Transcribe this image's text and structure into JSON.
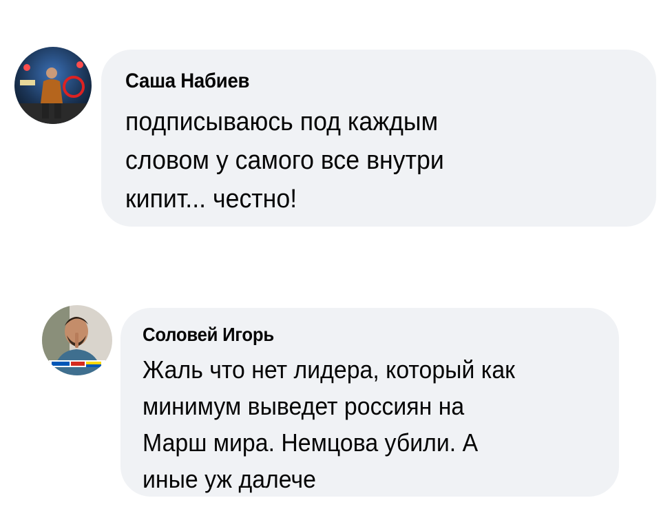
{
  "comments": [
    {
      "author": "Саша Набиев",
      "lines": [
        "подписываюсь под каждым",
        "словом у самого все внутри",
        "кипит... честно!"
      ],
      "avatar_icon": "user-avatar-photo"
    },
    {
      "author": "Соловей Игорь",
      "lines": [
        "Жаль что нет лидера, который как",
        "минимум выведет россиян на",
        "Марш мира. Немцова убили. А",
        "иные уж далече"
      ],
      "avatar_icon": "user-avatar-photo",
      "avatar_badge_colors": [
        "#0057b7",
        "#ffd700",
        "#d52b1e"
      ]
    }
  ],
  "colors": {
    "bubble_bg": "#f0f2f5",
    "text": "#050505"
  }
}
